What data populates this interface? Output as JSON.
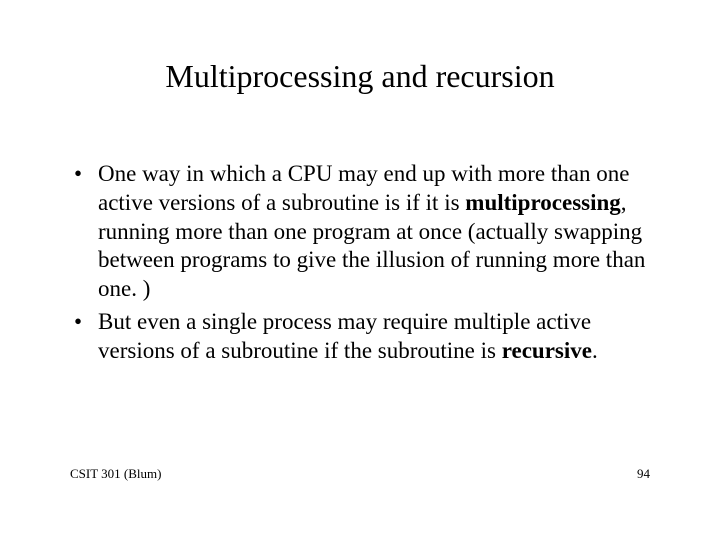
{
  "title": "Multiprocessing and recursion",
  "bullets": {
    "b1": {
      "pre": "One way in which a CPU may end up with more than one active versions of a subroutine is if it is ",
      "bold": "multiprocessing",
      "post": ", running more than one program at once (actually swapping between programs to give the illusion of running more than one. )"
    },
    "b2": {
      "pre": "But even a single process may require multiple active versions of a subroutine if the subroutine is ",
      "bold": "recursive",
      "post": "."
    }
  },
  "footer": {
    "left": "CSIT 301 (Blum)",
    "right": "94"
  }
}
